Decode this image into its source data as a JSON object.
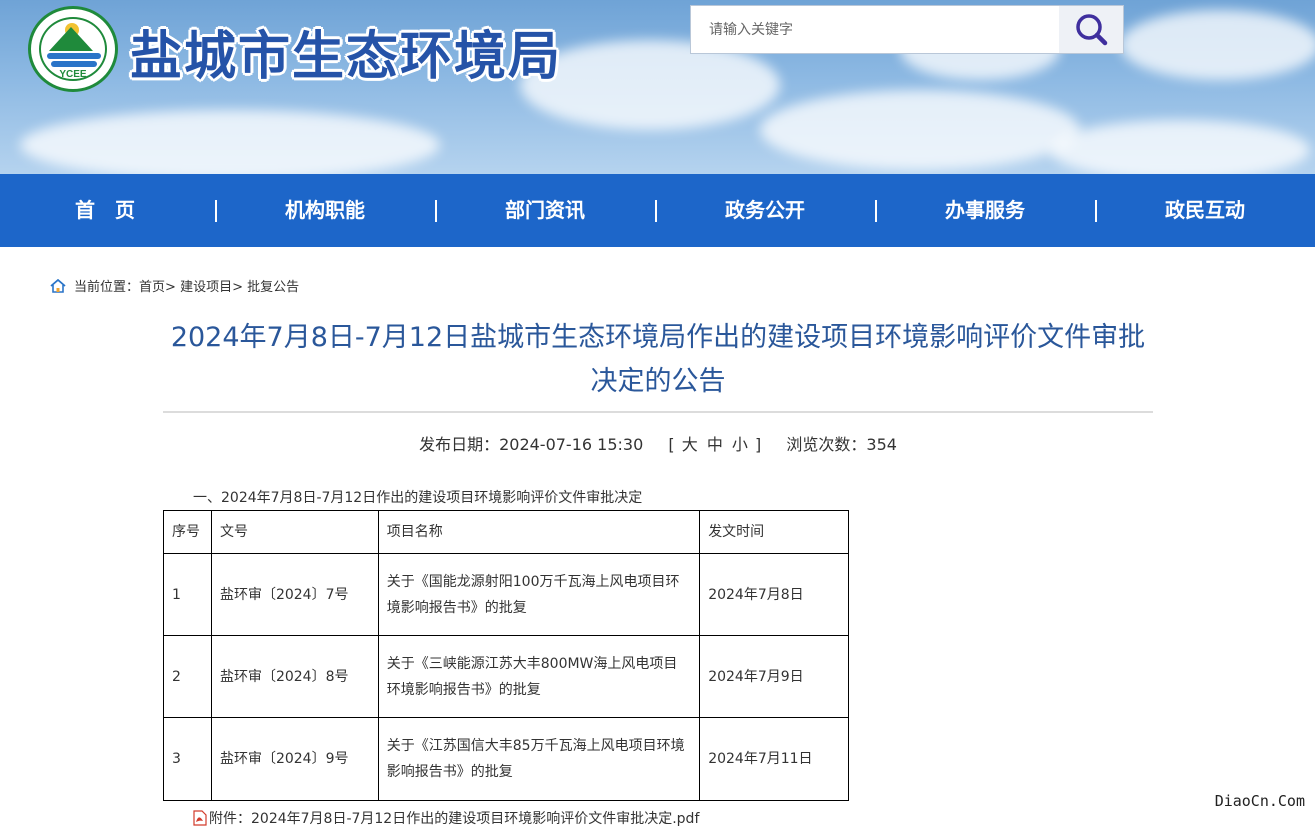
{
  "header": {
    "logo_text": "YCEE",
    "site_title": "盐城市生态环境局",
    "search_placeholder": "请输入关键字"
  },
  "nav": {
    "items": [
      {
        "label": "首　页"
      },
      {
        "label": "机构职能"
      },
      {
        "label": "部门资讯"
      },
      {
        "label": "政务公开"
      },
      {
        "label": "办事服务"
      },
      {
        "label": "政民互动"
      }
    ]
  },
  "breadcrumb": {
    "prefix": "当前位置：",
    "items": [
      "首页",
      "建设项目",
      "批复公告"
    ],
    "separator": ">"
  },
  "article": {
    "title_line1": "2024年7月8日-7月12日盐城市生态环境局作出的建设项目环境影响评价文件审批",
    "title_line2": "决定的公告",
    "publish_label": "发布日期：",
    "publish_date": "2024-07-16 15:30",
    "font_size_open": "[",
    "font_size_large": "大",
    "font_size_medium": "中",
    "font_size_small": "小",
    "font_size_close": "]",
    "views_label": "浏览次数：",
    "views": "354",
    "section_head": "一、2024年7月8日-7月12日作出的建设项目环境影响评价文件审批决定",
    "table": {
      "headers": [
        "序号",
        "文号",
        "项目名称",
        "发文时间"
      ],
      "rows": [
        {
          "no": "1",
          "doc": "盐环审〔2024〕7号",
          "name": "关于《国能龙源射阳100万千瓦海上风电项目环境影响报告书》的批复",
          "date": "2024年7月8日"
        },
        {
          "no": "2",
          "doc": "盐环审〔2024〕8号",
          "name": "关于《三峡能源江苏大丰800MW海上风电项目环境影响报告书》的批复",
          "date": "2024年7月9日"
        },
        {
          "no": "3",
          "doc": "盐环审〔2024〕9号",
          "name": "关于《江苏国信大丰85万千瓦海上风电项目环境影响报告书》的批复",
          "date": "2024年7月11日"
        }
      ]
    },
    "attachment_label": "附件：",
    "attachment_file": "2024年7月8日-7月12日作出的建设项目环境影响评价文件审批决定.pdf"
  },
  "watermark": "DiaoCn.Com",
  "colors": {
    "nav_bg": "#1d66c9",
    "title_color": "#2a579a",
    "brand_green": "#1f8a3b"
  }
}
